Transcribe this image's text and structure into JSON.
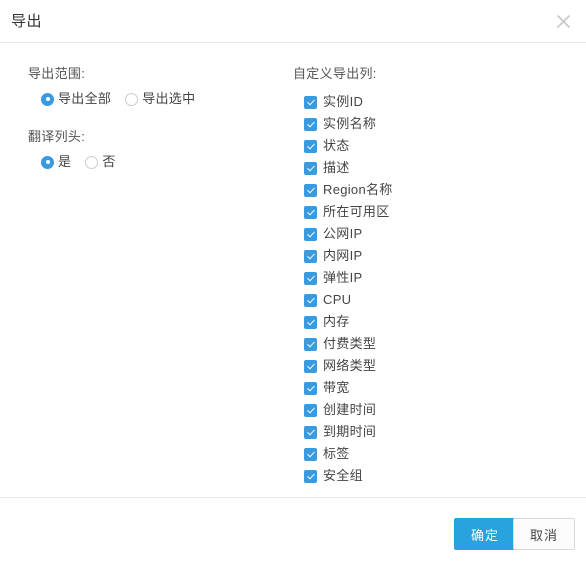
{
  "dialog": {
    "title": "导出",
    "close_icon": "close-icon"
  },
  "export_scope": {
    "label": "导出范围:",
    "options": [
      {
        "label": "导出全部",
        "checked": true
      },
      {
        "label": "导出选中",
        "checked": false
      }
    ]
  },
  "translate_header": {
    "label": "翻译列头:",
    "options": [
      {
        "label": "是",
        "checked": true
      },
      {
        "label": "否",
        "checked": false
      }
    ]
  },
  "custom_columns": {
    "label": "自定义导出列:",
    "items": [
      {
        "label": "实例ID",
        "checked": true
      },
      {
        "label": "实例名称",
        "checked": true
      },
      {
        "label": "状态",
        "checked": true
      },
      {
        "label": "描述",
        "checked": true
      },
      {
        "label": "Region名称",
        "checked": true
      },
      {
        "label": "所在可用区",
        "checked": true
      },
      {
        "label": "公网IP",
        "checked": true
      },
      {
        "label": "内网IP",
        "checked": true
      },
      {
        "label": "弹性IP",
        "checked": true
      },
      {
        "label": "CPU",
        "checked": true
      },
      {
        "label": "内存",
        "checked": true
      },
      {
        "label": "付费类型",
        "checked": true
      },
      {
        "label": "网络类型",
        "checked": true
      },
      {
        "label": "带宽",
        "checked": true
      },
      {
        "label": "创建时间",
        "checked": true
      },
      {
        "label": "到期时间",
        "checked": true
      },
      {
        "label": "标签",
        "checked": true
      },
      {
        "label": "安全组",
        "checked": true
      }
    ]
  },
  "footer": {
    "confirm_label": "确定",
    "cancel_label": "取消"
  },
  "colors": {
    "accent": "#28a3dd",
    "control_accent": "#3a9ae0",
    "border": "#e8e8e8",
    "text": "#444444"
  }
}
